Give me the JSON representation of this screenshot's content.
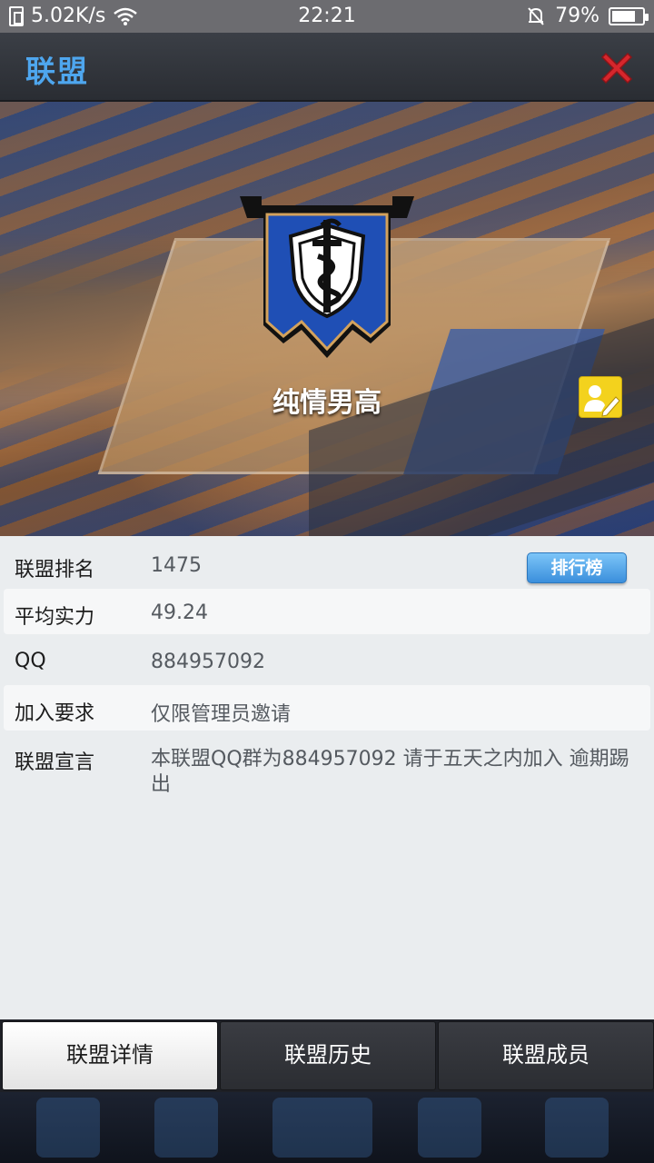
{
  "status_bar": {
    "net_speed": "5.02K/s",
    "time": "22:21",
    "battery": "79%"
  },
  "header": {
    "title": "联盟",
    "close_icon": "close-x-icon"
  },
  "banner": {
    "alliance_name": "纯情男高",
    "crest_icon": "alliance-crest-icon",
    "edit_icon": "edit-profile-icon"
  },
  "info": {
    "rank": {
      "label": "联盟排名",
      "value": "1475",
      "button": "排行榜"
    },
    "avg_power": {
      "label": "平均实力",
      "value": "49.24"
    },
    "qq": {
      "label": "QQ",
      "value": "884957092"
    },
    "join_requirement": {
      "label": "加入要求",
      "value": "仅限管理员邀请"
    },
    "declaration": {
      "label": "联盟宣言",
      "value": "本联盟QQ群为884957092 请于五天之内加入 逾期踢出"
    }
  },
  "tabs": [
    {
      "label": "联盟详情",
      "active": true
    },
    {
      "label": "联盟历史",
      "active": false
    },
    {
      "label": "联盟成员",
      "active": false
    }
  ],
  "colors": {
    "title_blue": "#4ea6ee",
    "crest_blue": "#1f4fb5",
    "edit_yellow": "#f3d21d",
    "rank_button_blue": "#3b8fdc"
  }
}
